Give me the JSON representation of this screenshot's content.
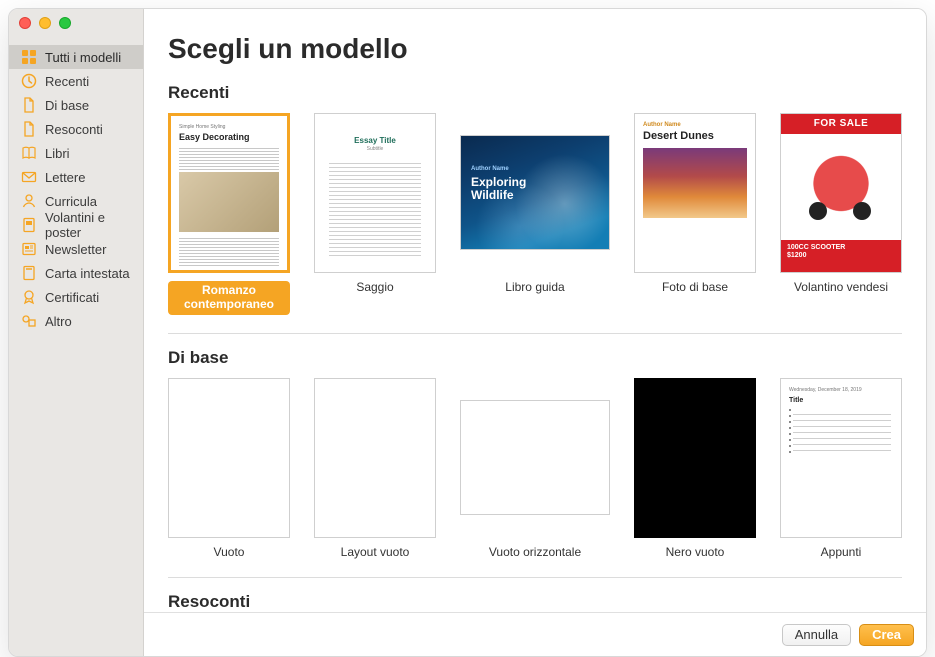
{
  "colors": {
    "accent": "#f5a523"
  },
  "page": {
    "title": "Scegli un modello"
  },
  "sidebar": {
    "items": [
      {
        "id": "all",
        "label": "Tutti i modelli",
        "icon": "grid-icon",
        "selected": true
      },
      {
        "id": "recent",
        "label": "Recenti",
        "icon": "clock-icon",
        "selected": false
      },
      {
        "id": "basic",
        "label": "Di base",
        "icon": "doc-icon",
        "selected": false
      },
      {
        "id": "reports",
        "label": "Resoconti",
        "icon": "doc-icon",
        "selected": false
      },
      {
        "id": "books",
        "label": "Libri",
        "icon": "book-icon",
        "selected": false
      },
      {
        "id": "letters",
        "label": "Lettere",
        "icon": "envelope-icon",
        "selected": false
      },
      {
        "id": "resumes",
        "label": "Curricula",
        "icon": "person-icon",
        "selected": false
      },
      {
        "id": "flyers",
        "label": "Volantini e poster",
        "icon": "poster-icon",
        "selected": false
      },
      {
        "id": "newsletter",
        "label": "Newsletter",
        "icon": "news-icon",
        "selected": false
      },
      {
        "id": "letterhead",
        "label": "Carta intestata",
        "icon": "letterhead-icon",
        "selected": false
      },
      {
        "id": "certs",
        "label": "Certificati",
        "icon": "ribbon-icon",
        "selected": false
      },
      {
        "id": "other",
        "label": "Altro",
        "icon": "shapes-icon",
        "selected": false
      }
    ]
  },
  "sections": {
    "recent": {
      "title": "Recenti",
      "cards": [
        {
          "label": "Romanzo contemporaneo",
          "selected": true,
          "landscape": false,
          "thumb": "easy",
          "thumb_text": {
            "a": "Simple Home Styling",
            "b": "Easy Decorating"
          }
        },
        {
          "label": "Saggio",
          "selected": false,
          "landscape": false,
          "thumb": "essay",
          "thumb_text": {
            "a": "Essay Title",
            "b": "Subtitle"
          }
        },
        {
          "label": "Libro guida",
          "selected": false,
          "landscape": true,
          "thumb": "wildlife",
          "thumb_text": {
            "a": "Author Name",
            "b": "Exploring Wildlife"
          }
        },
        {
          "label": "Foto di base",
          "selected": false,
          "landscape": false,
          "thumb": "dunes",
          "thumb_text": {
            "a": "Author Name",
            "b": "Desert Dunes"
          }
        },
        {
          "label": "Volantino vendesi",
          "selected": false,
          "landscape": false,
          "thumb": "sale",
          "thumb_text": {
            "a": "FOR SALE",
            "b": "100CC SCOOTER",
            "c": "$1200"
          }
        }
      ]
    },
    "basic": {
      "title": "Di base",
      "cards": [
        {
          "label": "Vuoto",
          "selected": false,
          "landscape": false,
          "thumb": "blank"
        },
        {
          "label": "Layout vuoto",
          "selected": false,
          "landscape": false,
          "thumb": "blank"
        },
        {
          "label": "Vuoto orizzontale",
          "selected": false,
          "landscape": true,
          "thumb": "blank-h",
          "thumb_text": {
            "a": ""
          }
        },
        {
          "label": "Nero vuoto",
          "selected": false,
          "landscape": false,
          "thumb": "black"
        },
        {
          "label": "Appunti",
          "selected": false,
          "landscape": false,
          "thumb": "notes",
          "thumb_text": {
            "a": "Wednesday, December 18, 2019",
            "b": "Title"
          }
        }
      ]
    },
    "reports": {
      "title": "Resoconti"
    }
  },
  "footer": {
    "cancel": "Annulla",
    "create": "Crea"
  }
}
